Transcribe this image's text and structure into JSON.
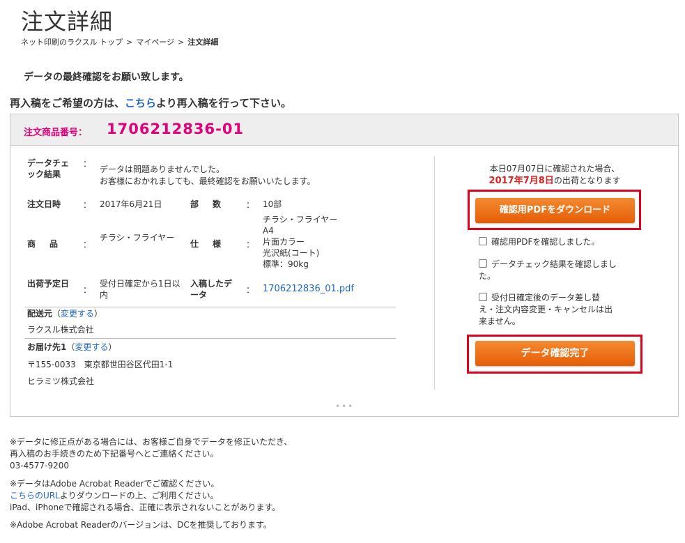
{
  "page": {
    "title": "注文詳細",
    "breadcrumb": [
      "ネット印刷のラクスル トップ",
      "マイページ",
      "注文詳細"
    ],
    "breadcrumb_sep": ">"
  },
  "notices": {
    "confirm_request": "データの最終確認をお願い致します。",
    "resubmit_prefix": "再入稿をご希望の方は、",
    "resubmit_link": "こちら",
    "resubmit_suffix": "より再入稿を行って下さい。"
  },
  "order": {
    "label": "注文商品番号：",
    "number": "1706212836-01"
  },
  "details": {
    "colon": "：",
    "data_check": {
      "label": "データチェック結果",
      "value_line1": "データは問題ありませんでした。",
      "value_line2": "お客様におかれましても、最終確認をお願いいたします。"
    },
    "order_date": {
      "label": "注文日時",
      "value": "2017年6月21日"
    },
    "quantity": {
      "label": "部　数",
      "value": "10部"
    },
    "product": {
      "label": "商　品",
      "value": "チラシ・フライヤー"
    },
    "spec": {
      "label": "仕　様",
      "lines": [
        "チラシ・フライヤー",
        "A4",
        "片面カラー",
        "光沢紙(コート)",
        "標準：90kg"
      ]
    },
    "ship_date": {
      "label": "出荷予定日",
      "value": "受付日確定から1日以内"
    },
    "submitted_data": {
      "label": "入稿したデータ",
      "value": "1706212836_01.pdf"
    },
    "sender": {
      "label": "配送元",
      "change_open": "（",
      "change_link": "変更する",
      "change_close": "）",
      "value": "ラクスル株式会社"
    },
    "delivery": {
      "label": "お届け先1",
      "change_open": "（",
      "change_link": "変更する",
      "change_close": "）",
      "address": "〒155-0033　東京都世田谷区代田1-1",
      "name": "ヒラミツ株式会社"
    }
  },
  "side": {
    "notice_line1": "本日07月07日に確認された場合、",
    "ship_date": "2017年7月8日",
    "notice_line2_suffix": "の出荷となります",
    "download_button": "確認用PDFをダウンロード",
    "checkboxes": [
      {
        "line1": "確認用PDFを確認しました。",
        "line2": "",
        "line3": ""
      },
      {
        "line1": "データチェック結果を確認しまし",
        "line2": "た。",
        "line3": ""
      },
      {
        "line1": "受付日確定後のデータ差し替",
        "line2": "え・注文内容変更・キャンセルは出",
        "line3": "来ません。"
      }
    ],
    "confirm_button": "データ確認完了",
    "more_dots": "•••"
  },
  "footer": {
    "note1_line1": "※データに修正点がある場合には、お客様ご自身でデータを修正いただき、",
    "note1_line2": "再入稿のお手続きのため下記番号へとご連絡ください。",
    "phone": "03-4577-9200",
    "note2_line1": "※データはAdobe Acrobat Readerでご確認ください。",
    "note2_link": "こちらのURL",
    "note2_line2_suffix": "よりダウンロードの上、ご利用ください。",
    "note2_line3": "iPad、iPhoneで確認される場合、正確に表示されないことがあります。",
    "note3": "※Adobe Acrobat Readerのバージョンは、DCを推奨しております。"
  },
  "colors": {
    "accent_magenta": "#e0007a",
    "button_orange": "#e8650a",
    "highlight_red": "#e4001b",
    "link_blue": "#2167c6"
  }
}
